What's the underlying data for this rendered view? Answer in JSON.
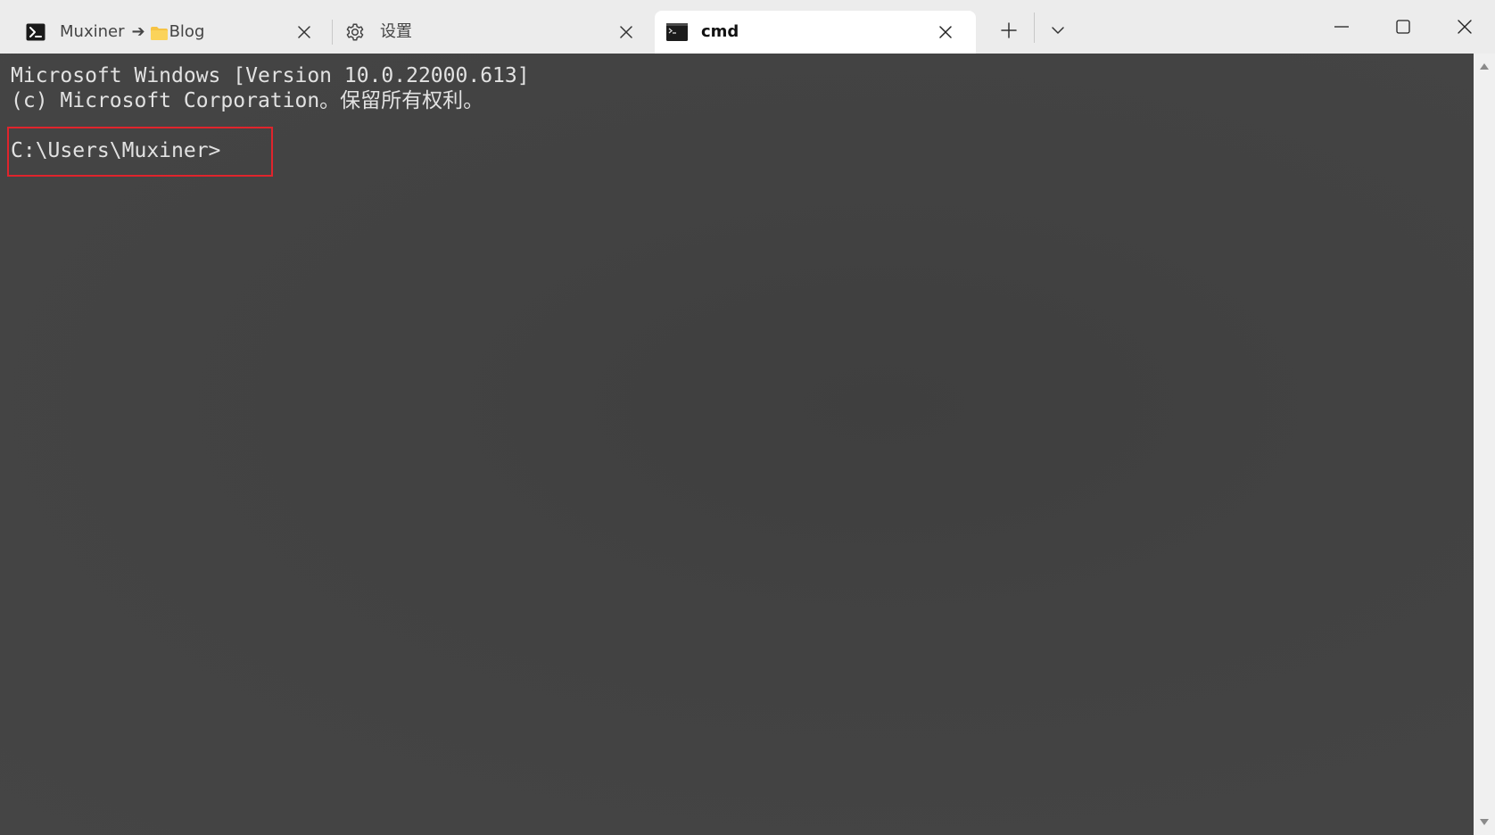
{
  "tabs": [
    {
      "icon": "terminal-prompt-icon",
      "title_user": "Muxiner",
      "title_arrow": "➔",
      "title_folder": "Blog",
      "active": false
    },
    {
      "icon": "gear-icon",
      "title": "设置",
      "active": false
    },
    {
      "icon": "cmd-icon",
      "title": "cmd",
      "active": true
    }
  ],
  "terminal": {
    "lines": [
      "Microsoft Windows [Version 10.0.22000.613]",
      "(c) Microsoft Corporation。保留所有权利。",
      "",
      "C:\\Users\\Muxiner>"
    ],
    "foreground_color": "#e2e2e2",
    "background_color": "#434343",
    "highlight_color": "#e0242c"
  },
  "icons": {
    "new_tab": "plus-icon",
    "dropdown": "chevron-down-icon",
    "minimize": "minimize-icon",
    "maximize": "maximize-icon",
    "close": "close-icon",
    "scroll_up": "scroll-up-arrow-icon",
    "scroll_down": "scroll-down-arrow-icon"
  }
}
